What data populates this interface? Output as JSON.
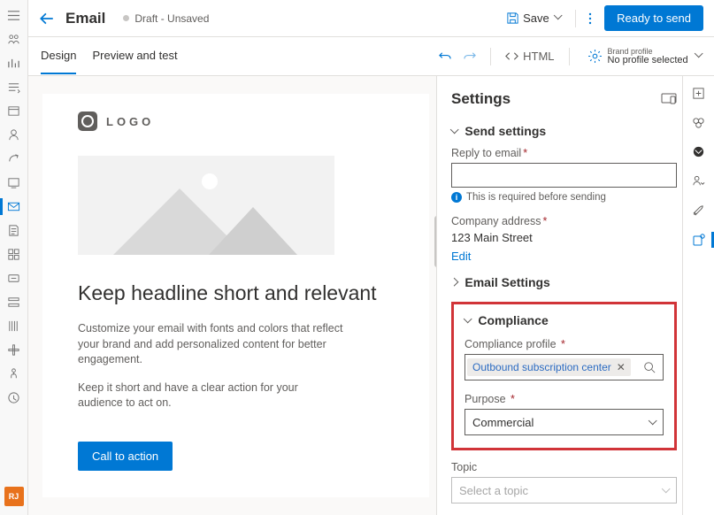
{
  "header": {
    "title": "Email",
    "draft_status": "Draft - Unsaved",
    "save_label": "Save",
    "ready_label": "Ready to send"
  },
  "subbar": {
    "tabs": {
      "design": "Design",
      "preview": "Preview and test"
    },
    "html_label": "HTML",
    "brand_l1": "Brand profile",
    "brand_l2": "No profile selected"
  },
  "canvas": {
    "logo_text": "LOGO",
    "headline": "Keep headline short and relevant",
    "para1": "Customize your email with fonts and colors that reflect your brand and add personalized content for better engagement.",
    "para2": "Keep it short and have a clear action for your audience to act on.",
    "cta": "Call to action"
  },
  "settings": {
    "title": "Settings",
    "send": {
      "heading": "Send settings",
      "reply_label": "Reply to email",
      "reply_required_msg": "This is required before sending",
      "company_label": "Company address",
      "company_value": "123 Main Street",
      "edit": "Edit"
    },
    "email_settings": {
      "heading": "Email Settings"
    },
    "compliance": {
      "heading": "Compliance",
      "profile_label": "Compliance profile",
      "profile_value": "Outbound subscription center",
      "purpose_label": "Purpose",
      "purpose_value": "Commercial"
    },
    "topic": {
      "label": "Topic",
      "placeholder": "Select a topic"
    }
  },
  "avatar": "RJ"
}
